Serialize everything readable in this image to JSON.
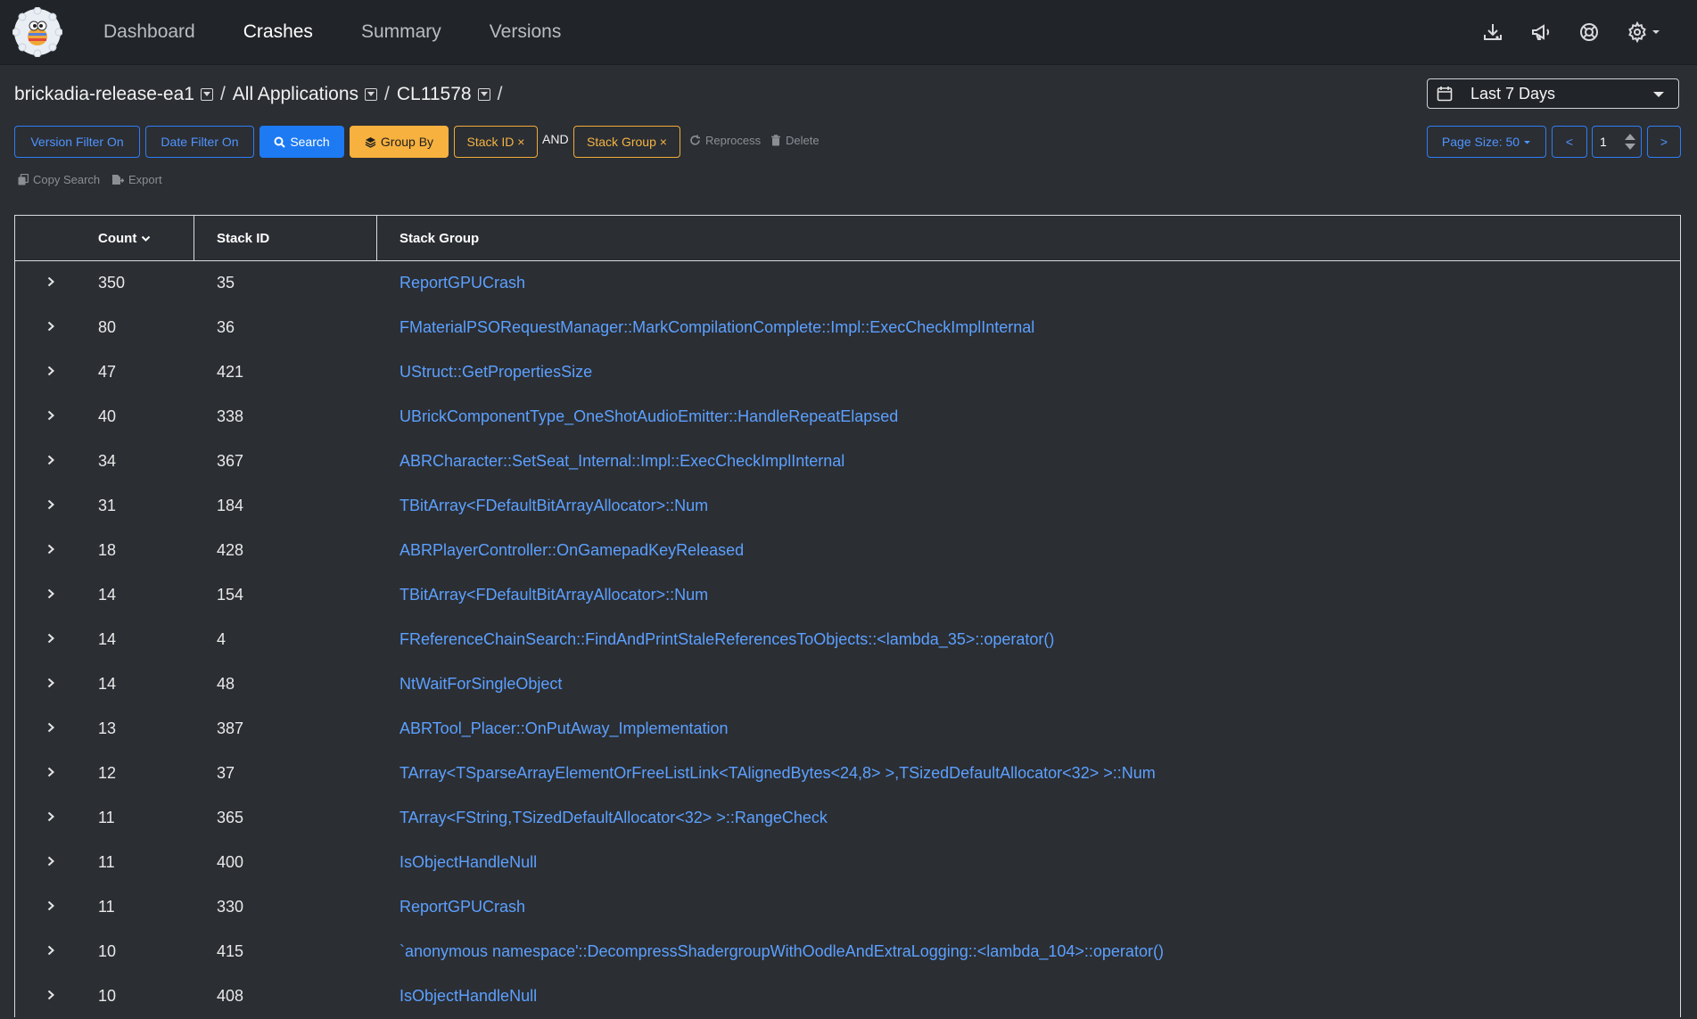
{
  "nav": {
    "links": [
      "Dashboard",
      "Crashes",
      "Summary",
      "Versions"
    ],
    "active": "Crashes",
    "icons": [
      "download-icon",
      "megaphone-icon",
      "lifebuoy-icon",
      "gear-icon"
    ]
  },
  "breadcrumb": {
    "items": [
      "brickadia-release-ea1",
      "All Applications",
      "CL11578"
    ],
    "separator": "/"
  },
  "date_range": {
    "label": "Last 7 Days"
  },
  "toolbar": {
    "version_filter": "Version Filter On",
    "date_filter": "Date Filter On",
    "search": "Search",
    "group_by": "Group By",
    "chip_stack_id": "Stack ID ×",
    "and": "AND",
    "chip_stack_group": "Stack Group ×",
    "reprocess": "Reprocess",
    "delete": "Delete",
    "copy_search": "Copy Search",
    "export": "Export",
    "page_size": "Page Size: 50",
    "prev": "<",
    "page": "1",
    "next": ">"
  },
  "table": {
    "headers": {
      "count": "Count",
      "stack_id": "Stack ID",
      "stack_group": "Stack Group"
    },
    "rows": [
      {
        "count": "350",
        "id": "35",
        "group": "ReportGPUCrash"
      },
      {
        "count": "80",
        "id": "36",
        "group": "FMaterialPSORequestManager::MarkCompilationComplete::Impl::ExecCheckImplInternal"
      },
      {
        "count": "47",
        "id": "421",
        "group": "UStruct::GetPropertiesSize"
      },
      {
        "count": "40",
        "id": "338",
        "group": "UBrickComponentType_OneShotAudioEmitter::HandleRepeatElapsed"
      },
      {
        "count": "34",
        "id": "367",
        "group": "ABRCharacter::SetSeat_Internal::Impl::ExecCheckImplInternal"
      },
      {
        "count": "31",
        "id": "184",
        "group": "TBitArray<FDefaultBitArrayAllocator>::Num"
      },
      {
        "count": "18",
        "id": "428",
        "group": "ABRPlayerController::OnGamepadKeyReleased"
      },
      {
        "count": "14",
        "id": "154",
        "group": "TBitArray<FDefaultBitArrayAllocator>::Num"
      },
      {
        "count": "14",
        "id": "4",
        "group": "FReferenceChainSearch::FindAndPrintStaleReferencesToObjects::<lambda_35>::operator()"
      },
      {
        "count": "14",
        "id": "48",
        "group": "NtWaitForSingleObject"
      },
      {
        "count": "13",
        "id": "387",
        "group": "ABRTool_Placer::OnPutAway_Implementation"
      },
      {
        "count": "12",
        "id": "37",
        "group": "TArray<TSparseArrayElementOrFreeListLink<TAlignedBytes<24,8> >,TSizedDefaultAllocator<32> >::Num"
      },
      {
        "count": "11",
        "id": "365",
        "group": "TArray<FString,TSizedDefaultAllocator<32> >::RangeCheck"
      },
      {
        "count": "11",
        "id": "400",
        "group": "IsObjectHandleNull"
      },
      {
        "count": "11",
        "id": "330",
        "group": "ReportGPUCrash"
      },
      {
        "count": "10",
        "id": "415",
        "group": "`anonymous namespace'::DecompressShadergroupWithOodleAndExtraLogging::<lambda_104>::operator()"
      },
      {
        "count": "10",
        "id": "408",
        "group": "IsObjectHandleNull"
      }
    ]
  }
}
